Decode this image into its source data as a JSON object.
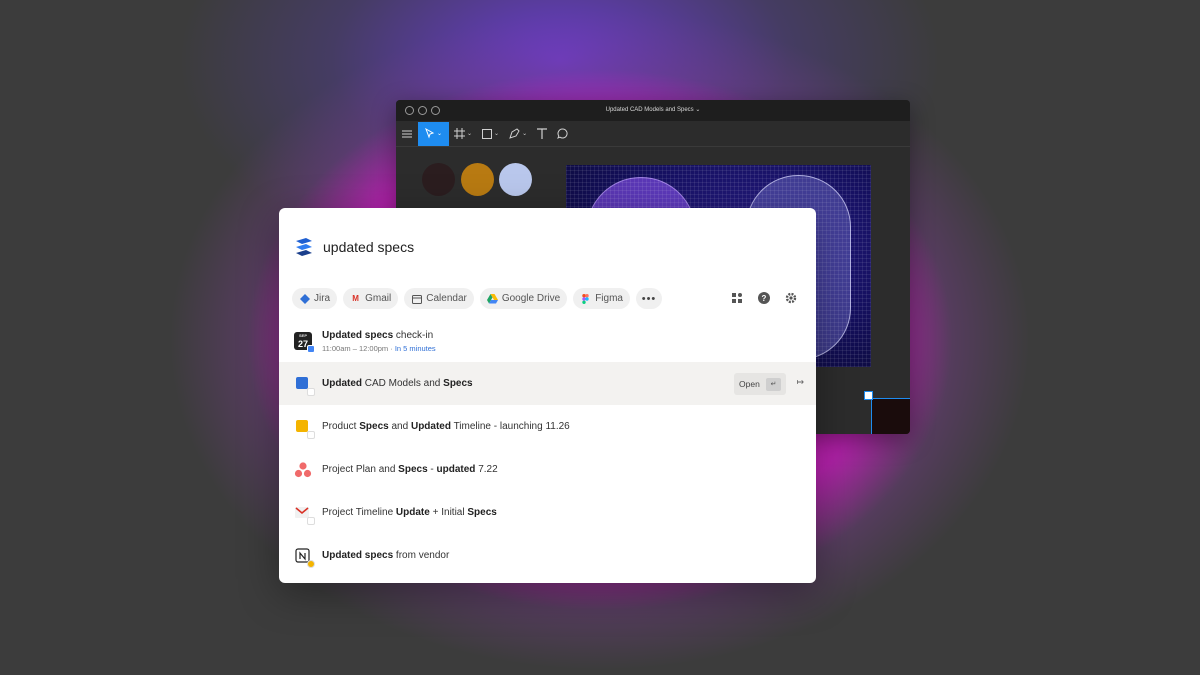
{
  "figma": {
    "title": "Updated CAD Models and Specs ⌄"
  },
  "search": {
    "query": "updated specs"
  },
  "filters": [
    {
      "label": "Jira",
      "color": "#2f6fd6"
    },
    {
      "label": "Gmail",
      "color": "#d93025"
    },
    {
      "label": "Calendar",
      "color": "#555555"
    },
    {
      "label": "Google Drive",
      "color": "#1fa463"
    },
    {
      "label": "Figma",
      "color": "#f24e1e"
    }
  ],
  "more_label": "•••",
  "results": [
    {
      "prefix": "Updated specs",
      "suffix": " check-in",
      "sub_time": "11:00am – 12:00pm · ",
      "sub_soon": "In 5 minutes",
      "cal_month": "SEP",
      "cal_day": "27"
    },
    {
      "parts": [
        "Updated",
        " CAD Models and ",
        "Specs"
      ],
      "open_label": "Open",
      "kbd": "↵",
      "out": "↦"
    },
    {
      "parts": [
        "Product ",
        "Specs",
        " and ",
        "Updated",
        " Timeline - launching 11.26"
      ]
    },
    {
      "parts": [
        "Project Plan and ",
        "Specs",
        " - ",
        "updated",
        " 7.22"
      ]
    },
    {
      "parts": [
        "Project Timeline ",
        "Update",
        " + Initial ",
        "Specs"
      ]
    },
    {
      "parts": [
        "Updated specs",
        " from vendor"
      ]
    }
  ],
  "colors": {
    "accent": "#1e8cf0",
    "background_magenta": "#e41ed0"
  }
}
